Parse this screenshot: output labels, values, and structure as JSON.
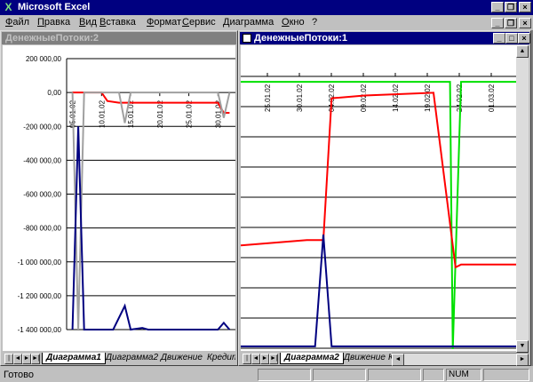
{
  "app": {
    "title": "Microsoft Excel",
    "icon": "excel-icon"
  },
  "menu": [
    "Файл",
    "Правка",
    "Вид",
    "Вставка",
    "Формат",
    "Сервис",
    "Диаграмма",
    "Окно",
    "?"
  ],
  "window_left": {
    "title": "ДенежныеПотоки:2",
    "tabs": [
      "Диаграмма1",
      "Диаграмма2",
      "Движение",
      "Кредит"
    ],
    "active_tab": 0
  },
  "window_right": {
    "title": "ДенежныеПотоки:1",
    "tabs": [
      "Диаграмма2",
      "Движение",
      "Кред"
    ],
    "active_tab": 0
  },
  "status": {
    "ready": "Готово",
    "num": "NUM"
  },
  "colors": {
    "red": "#ff0000",
    "navy": "#000080",
    "green": "#00e000",
    "gray": "#a0a0a0"
  },
  "chart_data": [
    {
      "type": "line",
      "y_tick_labels": [
        "200 000,00",
        "0,00",
        "-200 000,00",
        "-400 000,00",
        "-600 000,00",
        "-800 000,00",
        "-1 000 000,00",
        "-1 200 000,00",
        "-1 400 000,00"
      ],
      "y_ticks": [
        200000,
        0,
        -200000,
        -400000,
        -600000,
        -800000,
        -1000000,
        -1200000,
        -1400000
      ],
      "ylim": [
        -1400000,
        200000
      ],
      "x_tick_labels": [
        "05.01.02",
        "10.01.02",
        "15.01.02",
        "20.01.02",
        "25.01.02",
        "30.01.02"
      ],
      "grid": true,
      "series": [
        {
          "color": "red",
          "points": [
            [
              5,
              0
            ],
            [
              7.5,
              0
            ],
            [
              9,
              0
            ],
            [
              10,
              0
            ],
            [
              11,
              -50000
            ],
            [
              13,
              -60000
            ],
            [
              20,
              -60000
            ],
            [
              30,
              -60000
            ],
            [
              31,
              -120000
            ],
            [
              32,
              -120000
            ]
          ]
        },
        {
          "color": "gray",
          "points": [
            [
              5,
              0
            ],
            [
              6,
              -1400000
            ],
            [
              7,
              0
            ],
            [
              13,
              0
            ],
            [
              14,
              -180000
            ],
            [
              15,
              0
            ],
            [
              30,
              0
            ],
            [
              31,
              -150000
            ],
            [
              32,
              0
            ]
          ]
        },
        {
          "color": "navy",
          "points": [
            [
              5,
              -1400000
            ],
            [
              6,
              -200000
            ],
            [
              7,
              -1400000
            ],
            [
              12,
              -1400000
            ],
            [
              14,
              -1260000
            ],
            [
              15,
              -1400000
            ],
            [
              17,
              -1390000
            ],
            [
              18,
              -1400000
            ],
            [
              30,
              -1400000
            ],
            [
              31,
              -1360000
            ],
            [
              32,
              -1400000
            ]
          ]
        }
      ]
    },
    {
      "type": "line",
      "x_tick_labels": [
        "25.01.02",
        "30.01.02",
        "04.02.02",
        "09.02.02",
        "14.02.02",
        "19.02.02",
        "24.02.02",
        "01.03.02"
      ],
      "grid": true,
      "series": [
        {
          "color": "green",
          "points": [
            [
              0,
              0.02
            ],
            [
              0.74,
              0.02
            ],
            [
              0.76,
              0.02
            ],
            [
              0.77,
              1.0
            ],
            [
              0.8,
              0.02
            ],
            [
              1,
              0.02
            ]
          ]
        },
        {
          "color": "red",
          "points": [
            [
              0,
              0.62
            ],
            [
              0.24,
              0.6
            ],
            [
              0.3,
              0.6
            ],
            [
              0.33,
              0.08
            ],
            [
              0.45,
              0.07
            ],
            [
              0.7,
              0.06
            ],
            [
              0.78,
              0.7
            ],
            [
              0.8,
              0.69
            ],
            [
              0.95,
              0.69
            ],
            [
              1,
              0.69
            ]
          ]
        },
        {
          "color": "navy",
          "points": [
            [
              0,
              0.99
            ],
            [
              0.27,
              0.99
            ],
            [
              0.3,
              0.58
            ],
            [
              0.33,
              0.99
            ],
            [
              1,
              0.99
            ]
          ]
        }
      ]
    }
  ]
}
